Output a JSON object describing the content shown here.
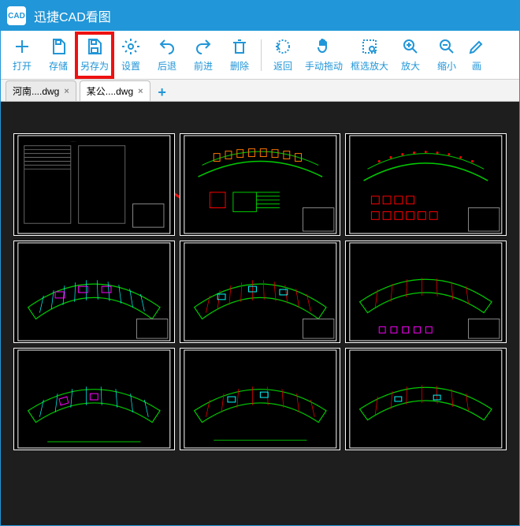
{
  "app": {
    "title": "迅捷CAD看图",
    "icon_label": "CAD"
  },
  "toolbar": {
    "open": "打开",
    "save": "存储",
    "saveas": "另存为",
    "settings": "设置",
    "back": "后退",
    "forward": "前进",
    "delete": "删除",
    "return": "返回",
    "pan": "手动拖动",
    "zoom_window": "框选放大",
    "zoom_in": "放大",
    "zoom_out": "缩小",
    "draw": "画"
  },
  "tabs": [
    {
      "label": "河南....dwg",
      "active": false
    },
    {
      "label": "某公....dwg",
      "active": true
    }
  ]
}
